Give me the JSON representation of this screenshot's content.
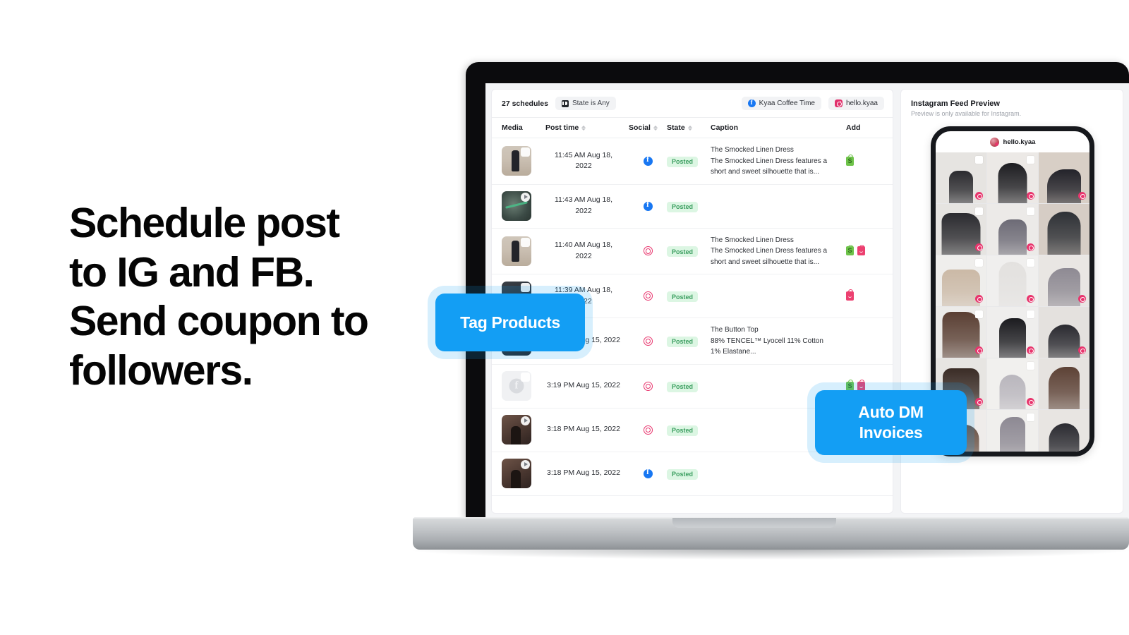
{
  "headline": {
    "lines": [
      "Schedule post",
      "to IG and FB.",
      "Send coupon to",
      "followers."
    ]
  },
  "callouts": {
    "tag_products": "Tag Products",
    "auto_dm_invoices": "Auto DM\nInvoices"
  },
  "app": {
    "toolbar": {
      "schedules_count": "27 schedules",
      "state_filter": "State is Any",
      "accounts": [
        {
          "name": "Kyaa Coffee Time",
          "platform": "facebook"
        },
        {
          "name": "hello.kyaa",
          "platform": "instagram"
        }
      ]
    },
    "table": {
      "columns": [
        {
          "key": "media",
          "label": "Media",
          "sortable": false
        },
        {
          "key": "time",
          "label": "Post time",
          "sortable": true
        },
        {
          "key": "social",
          "label": "Social",
          "sortable": true
        },
        {
          "key": "state",
          "label": "State",
          "sortable": true
        },
        {
          "key": "caption",
          "label": "Caption",
          "sortable": false
        },
        {
          "key": "add",
          "label": "Add",
          "sortable": false
        }
      ],
      "rows": [
        {
          "thumb": "dress",
          "thumb_badge": "select",
          "time": "11:45 AM Aug 18,\n2022",
          "social": "facebook",
          "state": "Posted",
          "caption_title": "The Smocked Linen Dress",
          "caption_body": "The Smocked Linen Dress features a\nshort and sweet silhouette that is...",
          "add": [
            "shopify"
          ]
        },
        {
          "thumb": "video",
          "thumb_badge": "play",
          "time": "11:43 AM Aug 18,\n2022",
          "social": "facebook",
          "state": "Posted",
          "caption_title": "",
          "caption_body": "",
          "add": []
        },
        {
          "thumb": "dress",
          "thumb_badge": "select",
          "time": "11:40 AM Aug 18,\n2022",
          "social": "instagram",
          "state": "Posted",
          "caption_title": "The Smocked Linen Dress",
          "caption_body": "The Smocked Linen Dress features a\nshort and sweet silhouette that is...",
          "add": [
            "shopify",
            "pinkbag"
          ]
        },
        {
          "thumb": "dark",
          "thumb_badge": "select",
          "time": "11:39 AM Aug 18,\n2022",
          "social": "instagram",
          "state": "Posted",
          "caption_title": "",
          "caption_body": "",
          "add": [
            "pinkbag"
          ]
        },
        {
          "thumb": "dark",
          "thumb_badge": "select",
          "time": "3:20 PM Aug 15, 2022",
          "social": "instagram",
          "state": "Posted",
          "caption_title": "The Button Top",
          "caption_body": "88% TENCEL™ Lyocell 11% Cotton\n1% Elastane...",
          "add": []
        },
        {
          "thumb": "facebook-placeholder",
          "thumb_badge": "select",
          "time": "3:19 PM Aug 15, 2022",
          "social": "instagram",
          "state": "Posted",
          "caption_title": "",
          "caption_body": "",
          "add": [
            "shopify",
            "pinkbag"
          ]
        },
        {
          "thumb": "brown",
          "thumb_badge": "play",
          "time": "3:18 PM Aug 15, 2022",
          "social": "instagram",
          "state": "Posted",
          "caption_title": "",
          "caption_body": "",
          "add": []
        },
        {
          "thumb": "brown",
          "thumb_badge": "play",
          "time": "3:18 PM Aug 15, 2022",
          "social": "facebook",
          "state": "Posted",
          "caption_title": "",
          "caption_body": "",
          "add": []
        }
      ]
    },
    "preview": {
      "title": "Instagram Feed Preview",
      "subtitle": "Preview is only available for Instagram.",
      "phone": {
        "account_name": "hello.kyaa",
        "grid_cells": [
          {
            "tone": "#e6e4e1",
            "accent": "#2b2b2f",
            "selected": true,
            "tagged": true
          },
          {
            "tone": "#ece9e6",
            "accent": "#1d1d21",
            "selected": true,
            "tagged": true
          },
          {
            "tone": "#d8cfc6",
            "accent": "#23232a",
            "selected": false,
            "tagged": true
          },
          {
            "tone": "#e6e4e1",
            "accent": "#2b2b2f",
            "selected": true,
            "tagged": true
          },
          {
            "tone": "#eceae8",
            "accent": "#6d6b76",
            "selected": true,
            "tagged": true
          },
          {
            "tone": "#d6cdc5",
            "accent": "#2e3136",
            "selected": false,
            "tagged": false
          },
          {
            "tone": "#efeeec",
            "accent": "#cbb9a6",
            "selected": true,
            "tagged": true
          },
          {
            "tone": "#f0efee",
            "accent": "#e3e1df",
            "selected": true,
            "tagged": true
          },
          {
            "tone": "#e9e6e3",
            "accent": "#8e8a93",
            "selected": false,
            "tagged": true
          },
          {
            "tone": "#ecebe9",
            "accent": "#5a3f33",
            "selected": true,
            "tagged": true
          },
          {
            "tone": "#efeeed",
            "accent": "#1b1b1f",
            "selected": true,
            "tagged": true
          },
          {
            "tone": "#e4e1de",
            "accent": "#2a2a30",
            "selected": false,
            "tagged": true
          },
          {
            "tone": "#e7e5e2",
            "accent": "#3a2c26",
            "selected": false,
            "tagged": true
          },
          {
            "tone": "#f1f0ee",
            "accent": "#b9b6bd",
            "selected": true,
            "tagged": true
          },
          {
            "tone": "#e6e3e0",
            "accent": "#5d4236",
            "selected": false,
            "tagged": false
          },
          {
            "tone": "#efecea",
            "accent": "#6b5347",
            "selected": false,
            "tagged": false
          },
          {
            "tone": "#f0efed",
            "accent": "#8d8993",
            "selected": true,
            "tagged": false
          },
          {
            "tone": "#e8e5e2",
            "accent": "#2b2b31",
            "selected": false,
            "tagged": false
          }
        ]
      }
    }
  },
  "colors": {
    "accent_blue": "#139ef4",
    "facebook": "#1877f2",
    "instagram": "#e8356d",
    "posted_bg": "#dcf6e3",
    "posted_text": "#3a9e5f",
    "shopify_green": "#6ec34a"
  }
}
